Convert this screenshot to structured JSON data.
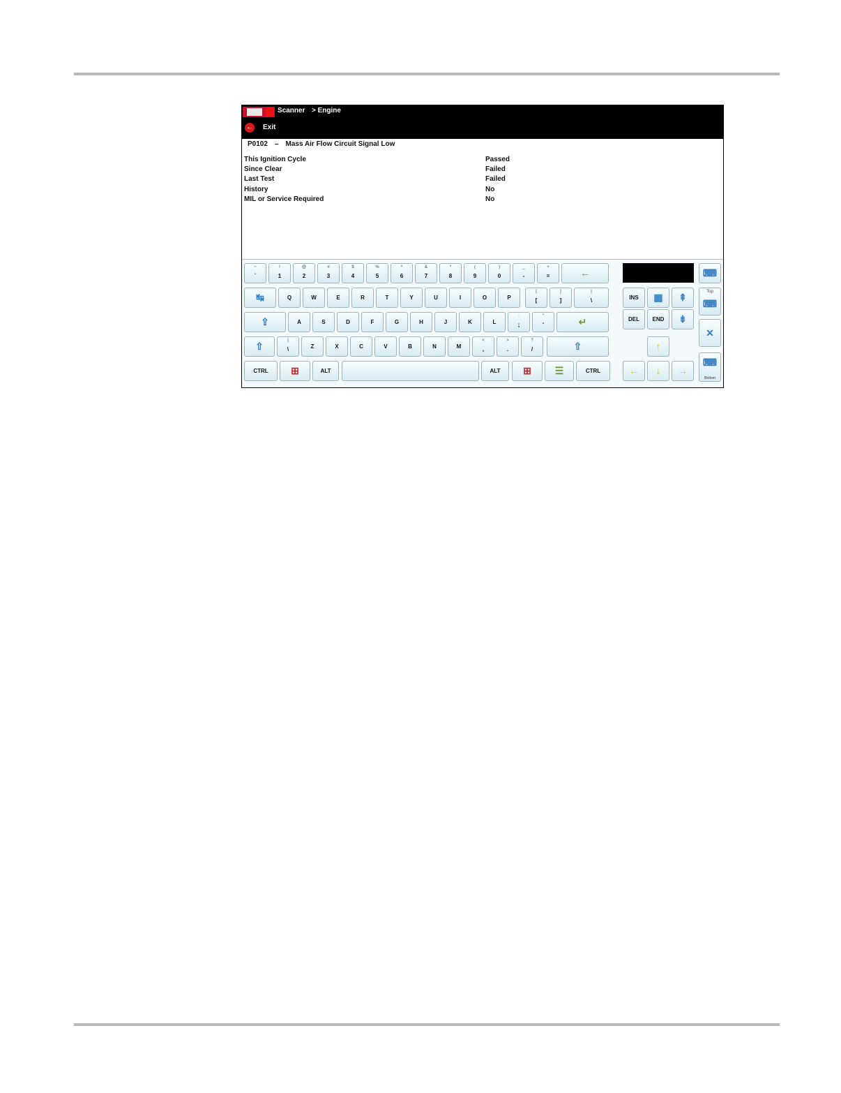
{
  "header": {
    "breadcrumb_scanner": "Scanner",
    "breadcrumb_engine": "> Engine",
    "exit_label": "Exit"
  },
  "code": {
    "id": "P0102",
    "separator": "–",
    "description": "Mass Air Flow Circuit Signal Low"
  },
  "status_rows": [
    {
      "label": "This Ignition Cycle",
      "value": "Passed"
    },
    {
      "label": "Since Clear",
      "value": "Failed"
    },
    {
      "label": "Last Test",
      "value": "Failed"
    },
    {
      "label": "History",
      "value": "No"
    },
    {
      "label": "MIL or Service Required",
      "value": "No"
    }
  ],
  "keyboard": {
    "row1": [
      {
        "main": "`",
        "sub": "~"
      },
      {
        "main": "1",
        "sub": "!"
      },
      {
        "main": "2",
        "sub": "@"
      },
      {
        "main": "3",
        "sub": "#"
      },
      {
        "main": "4",
        "sub": "$"
      },
      {
        "main": "5",
        "sub": "%"
      },
      {
        "main": "6",
        "sub": "^"
      },
      {
        "main": "7",
        "sub": "&"
      },
      {
        "main": "8",
        "sub": "*"
      },
      {
        "main": "9",
        "sub": "("
      },
      {
        "main": "0",
        "sub": ")"
      },
      {
        "main": "-",
        "sub": "_"
      },
      {
        "main": "=",
        "sub": "+"
      }
    ],
    "row2": [
      {
        "main": "Q"
      },
      {
        "main": "W"
      },
      {
        "main": "E"
      },
      {
        "main": "R"
      },
      {
        "main": "T"
      },
      {
        "main": "Y"
      },
      {
        "main": "U"
      },
      {
        "main": "I"
      },
      {
        "main": "O"
      },
      {
        "main": "P"
      },
      {
        "main": "[",
        "sub": "{"
      },
      {
        "main": "]",
        "sub": "}"
      },
      {
        "main": "\\",
        "sub": "|"
      }
    ],
    "row3": [
      {
        "main": "A"
      },
      {
        "main": "S"
      },
      {
        "main": "D"
      },
      {
        "main": "F"
      },
      {
        "main": "G"
      },
      {
        "main": "H"
      },
      {
        "main": "J"
      },
      {
        "main": "K"
      },
      {
        "main": "L"
      },
      {
        "main": ";",
        "sub": ":"
      },
      {
        "main": "'",
        "sub": "\""
      }
    ],
    "row4": [
      {
        "main": "\\",
        "sub": "|"
      },
      {
        "main": "Z"
      },
      {
        "main": "X"
      },
      {
        "main": "C"
      },
      {
        "main": "V"
      },
      {
        "main": "B"
      },
      {
        "main": "N"
      },
      {
        "main": "M"
      },
      {
        "main": ",",
        "sub": "<"
      },
      {
        "main": ".",
        "sub": ">"
      },
      {
        "main": "/",
        "sub": "?"
      }
    ],
    "ctrl": "CTRL",
    "alt": "ALT",
    "ins": "INS",
    "del": "DEL",
    "end": "END",
    "top_label": "Top",
    "bottom_label": "Bottom"
  }
}
